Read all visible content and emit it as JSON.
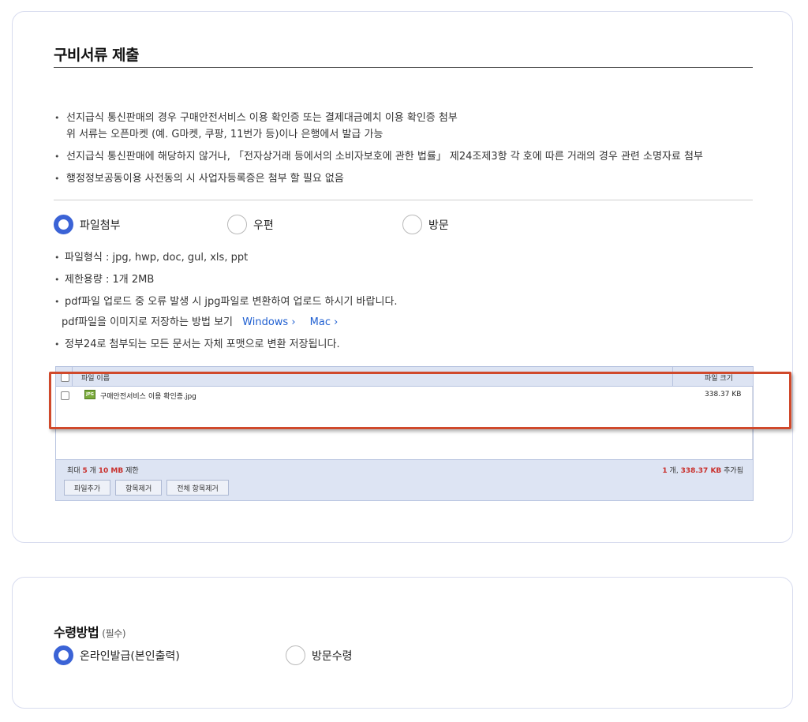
{
  "documents": {
    "title": "구비서류 제출",
    "bullets": [
      "선지급식 통신판매의 경우 구매안전서비스 이용 확인증 또는 결제대금예치 이용 확인증 첨부",
      "위 서류는 오픈마켓 (예. G마켓, 쿠팡, 11번가 등)이나 은행에서 발급 가능",
      "선지급식 통신판매에 해당하지 않거나, 「전자상거래 등에서의 소비자보호에 관한 법률」 제24조제3항 각 호에 따른 거래의 경우 관련 소명자료 첨부",
      "행정정보공동이용 사전동의 시 사업자등록증은 첨부 할 필요 없음"
    ],
    "submit_methods": [
      {
        "label": "파일첨부",
        "selected": true
      },
      {
        "label": "우편",
        "selected": false
      },
      {
        "label": "방문",
        "selected": false
      }
    ],
    "info": {
      "file_types": "파일형식 : jpg, hwp, doc, gul, xls, ppt",
      "size_limit": "제한용량 : 1개 2MB",
      "pdf_notice": "pdf파일 업로드 중 오류 발생 시 jpg파일로 변환하여 업로드 하시기 바랍니다.",
      "pdf_howto": "pdf파일을 이미지로 저장하는 방법 보기",
      "link_windows": "Windows  ›",
      "link_mac": "Mac  ›",
      "format_notice": "정부24로 첨부되는 모든 문서는 자체 포맷으로 변환 저장됩니다."
    },
    "uploader": {
      "col_name": "파일 이름",
      "col_size": "파일 크기",
      "files": [
        {
          "icon": "JPG",
          "name": "구매안전서비스 이용 확인증.jpg",
          "size": "338.37 KB",
          "checked": false
        }
      ],
      "limit_prefix": "최대",
      "limit_count": "5",
      "limit_mid": "개",
      "limit_size": "10 MB",
      "limit_suffix": "제한",
      "added_count": "1",
      "added_mid": "개,",
      "added_size": "338.37 KB",
      "added_suffix": "추가됨",
      "buttons": {
        "add": "파일추가",
        "remove": "항목제거",
        "remove_all": "전체 항목제거"
      }
    }
  },
  "receipt": {
    "title": "수령방법",
    "required": "(필수)",
    "options": [
      {
        "label": "온라인발급(본인출력)",
        "selected": true
      },
      {
        "label": "방문수령",
        "selected": false
      }
    ]
  },
  "colors": {
    "accent": "#3b63d6",
    "link": "#1f5fd1",
    "highlight": "#d0492b",
    "red_text": "#c9302c"
  }
}
